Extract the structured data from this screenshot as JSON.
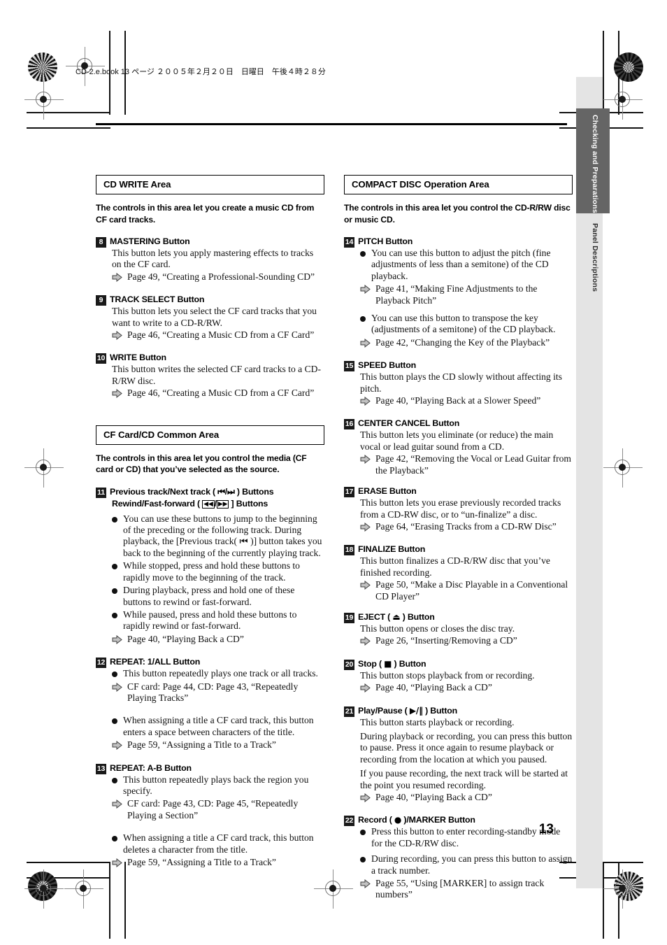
{
  "header": {
    "file_line": "CD-2.e.book  13 ページ  ２００５年２月２０日　日曜日　午後４時２８分",
    "page_number": "13"
  },
  "side_tabs": [
    {
      "label": "Checking and Preparations",
      "active": true
    },
    {
      "label": "Panel Descriptions",
      "active": false
    }
  ],
  "left_column": {
    "section1": {
      "title": "CD WRITE Area",
      "intro": "The controls in this area let you create a music CD from CF card tracks.",
      "items": [
        {
          "num": "8",
          "title": "MASTERING Button",
          "body": [
            "This button lets you apply mastering effects to tracks on the CF card."
          ],
          "refs": [
            "Page 49, “Creating a Professional-Sounding CD”"
          ]
        },
        {
          "num": "9",
          "title": "TRACK SELECT Button",
          "body": [
            "This button lets you select the CF card tracks that you want to write to a CD-R/RW."
          ],
          "refs": [
            "Page 46, “Creating a Music CD from a CF Card”"
          ]
        },
        {
          "num": "10",
          "title": "WRITE Button",
          "body": [
            "This button writes the selected CF card tracks to a CD-R/RW disc."
          ],
          "refs": [
            "Page 46, “Creating a Music CD from a CF Card”"
          ]
        }
      ]
    },
    "section2": {
      "title": "CF Card/CD Common Area",
      "intro": "The controls in this area let you control the media (CF card or CD) that you’ve selected as the source.",
      "item11": {
        "num": "11",
        "title_prefix": "Previous track/Next track ( ",
        "title_suffix": " ) Buttons",
        "title_sym_a": "⏮",
        "title_sym_b": "⏭",
        "subtitle_prefix": "Rewind/Fast-forward ( ",
        "subtitle_suffix": " ] Buttons",
        "subtitle_sym_a": "◀◀",
        "subtitle_sym_b": "▶▶",
        "bullets": [
          "You can use these buttons to jump to the beginning of the preceding or the following track. During playback, the [Previous track( ⏮ )] button takes you back to the beginning of the currently playing track.",
          "While stopped, press and hold these buttons to rapidly move to the beginning of the track.",
          "During playback, press and hold one of these buttons to rewind or fast-forward.",
          "While paused, press and hold these buttons to rapidly rewind or fast-forward."
        ],
        "refs": [
          "Page 40, “Playing Back a CD”"
        ]
      },
      "item12": {
        "num": "12",
        "title": "REPEAT: 1/ALL Button",
        "group_a": {
          "bullets": [
            "This button repeatedly plays one track or all tracks."
          ],
          "refs": [
            "CF card: Page 44, CD: Page 43, “Repeatedly Playing Tracks”"
          ]
        },
        "group_b": {
          "bullets": [
            "When assigning a title a CF card track, this button enters a space between characters of the title."
          ],
          "refs": [
            "Page 59, “Assigning a Title to a Track”"
          ]
        }
      },
      "item13": {
        "num": "13",
        "title": "REPEAT: A-B Button",
        "group_a": {
          "bullets": [
            "This button repeatedly plays back the region you specify."
          ],
          "refs": [
            "CF card: Page 43, CD: Page 45, “Repeatedly Playing a Section”"
          ]
        },
        "group_b": {
          "bullets": [
            "When assigning a title a CF card track, this button deletes a character from the title."
          ],
          "refs": [
            "Page 59, “Assigning a Title to a Track”"
          ]
        }
      }
    }
  },
  "right_column": {
    "section": {
      "title": "COMPACT DISC Operation Area",
      "intro": "The controls in this area let you control the CD-R/RW disc or music CD."
    },
    "item14": {
      "num": "14",
      "title": "PITCH Button",
      "group_a": {
        "bullets": [
          "You can use this button to adjust the pitch (fine adjustments of less than a semitone) of the CD playback."
        ],
        "refs": [
          "Page 41, “Making Fine Adjustments to the Playback Pitch”"
        ]
      },
      "group_b": {
        "bullets": [
          "You can use this button to transpose the key (adjustments of a semitone) of the CD playback."
        ],
        "refs": [
          "Page 42, “Changing the Key of the Playback”"
        ]
      }
    },
    "item15": {
      "num": "15",
      "title": "SPEED Button",
      "body": [
        "This button plays the CD slowly without affecting its pitch."
      ],
      "refs": [
        "Page 40, “Playing Back at a Slower Speed”"
      ]
    },
    "item16": {
      "num": "16",
      "title": "CENTER CANCEL Button",
      "body": [
        "This button lets you eliminate (or reduce) the main vocal or lead guitar sound from a CD."
      ],
      "refs": [
        "Page 42, “Removing the Vocal or Lead Guitar from the Playback”"
      ]
    },
    "item17": {
      "num": "17",
      "title": "ERASE Button",
      "body": [
        "This button lets you erase previously recorded tracks from a CD-RW disc, or to “un-finalize” a disc."
      ],
      "refs": [
        "Page 64, “Erasing Tracks from a CD-RW Disc”"
      ]
    },
    "item18": {
      "num": "18",
      "title": "FINALIZE Button",
      "body": [
        "This button finalizes a CD-R/RW disc that you’ve finished recording."
      ],
      "refs": [
        "Page 50, “Make a Disc Playable in a Conventional CD Player”"
      ]
    },
    "item19": {
      "num": "19",
      "title_prefix": "EJECT ( ",
      "title_sym": "⏏",
      "title_suffix": " ) Button",
      "body": [
        "This button opens or closes the disc tray."
      ],
      "refs": [
        "Page 26, “Inserting/Removing a CD”"
      ]
    },
    "item20": {
      "num": "20",
      "title_prefix": "Stop ( ",
      "title_sym": "■",
      "title_suffix": " ) Button",
      "body": [
        "This button stops playback from or recording."
      ],
      "refs": [
        "Page 40, “Playing Back a CD”"
      ]
    },
    "item21": {
      "num": "21",
      "title_prefix": "Play/Pause ( ",
      "title_sym": "▶/‖",
      "title_suffix": " ) Button",
      "body": [
        "This button starts playback or recording.",
        "During playback or recording, you can press this button to pause. Press it once again to resume playback or recording from the location at which you paused.",
        "If you pause recording, the next track will be started at the point you resumed recording."
      ],
      "refs": [
        "Page 40, “Playing Back a CD”"
      ]
    },
    "item22": {
      "num": "22",
      "title_prefix": "Record ( ",
      "title_sym": "●",
      "title_suffix": " )/MARKER Button",
      "bullets": [
        "Press this button to enter recording-standby mode for the CD-R/RW disc.",
        "During recording, you can press this button to assign a track number."
      ],
      "refs": [
        "Page 55, “Using [MARKER] to assign track numbers”"
      ]
    }
  },
  "colors": {
    "tab_active_bg": "#656565",
    "side_band_bg": "#e4e4e4",
    "badge_bg": "#1a1a1a",
    "arrow_fill": "#bdbdbd",
    "arrow_stroke": "#4a4a4a"
  }
}
